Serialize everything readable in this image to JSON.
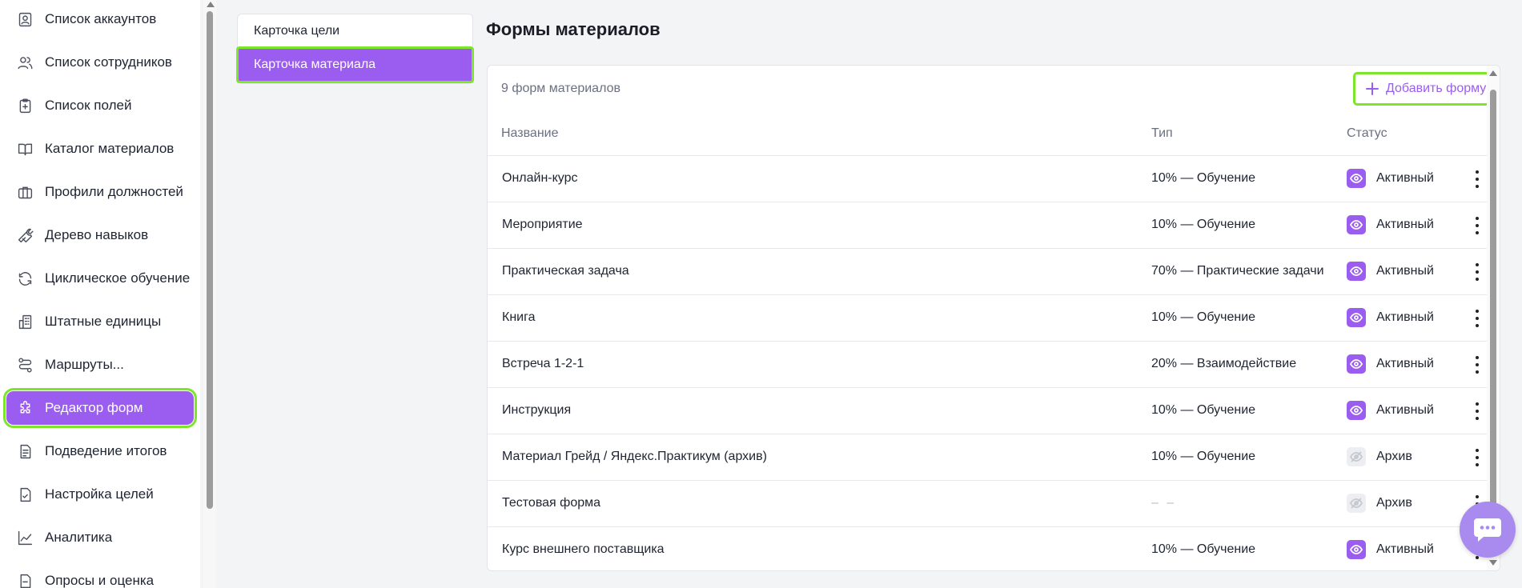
{
  "sidebar": {
    "items": [
      {
        "label": "Список аккаунтов",
        "icon": "user-card-icon"
      },
      {
        "label": "Список сотрудников",
        "icon": "users-icon"
      },
      {
        "label": "Список полей",
        "icon": "clipboard-plus-icon"
      },
      {
        "label": "Каталог материалов",
        "icon": "book-icon"
      },
      {
        "label": "Профили должностей",
        "icon": "briefcase-icon"
      },
      {
        "label": "Дерево навыков",
        "icon": "wrench-icon"
      },
      {
        "label": "Циклическое обучение",
        "icon": "refresh-icon"
      },
      {
        "label": "Штатные единицы",
        "icon": "building-icon"
      },
      {
        "label": "Маршруты...",
        "icon": "route-icon"
      },
      {
        "label": "Редактор форм",
        "icon": "puzzle-icon",
        "active": true
      },
      {
        "label": "Подведение итогов",
        "icon": "document-list-icon"
      },
      {
        "label": "Настройка целей",
        "icon": "document-check-icon"
      },
      {
        "label": "Аналитика",
        "icon": "chart-line-icon"
      },
      {
        "label": "Опросы и оценка",
        "icon": "document-icon"
      }
    ]
  },
  "subnav": {
    "items": [
      {
        "label": "Карточка цели"
      },
      {
        "label": "Карточка материала",
        "active": true
      }
    ]
  },
  "main": {
    "title": "Формы материалов",
    "count": "9 форм материалов",
    "add_label": "Добавить форму",
    "columns": {
      "name": "Название",
      "type": "Тип",
      "status": "Статус"
    },
    "rows": [
      {
        "name": "Онлайн-курс",
        "type": "10% — Обучение",
        "status": "Активный",
        "active": true
      },
      {
        "name": "Мероприятие",
        "type": "10% — Обучение",
        "status": "Активный",
        "active": true
      },
      {
        "name": "Практическая задача",
        "type": "70% — Практические задачи",
        "status": "Активный",
        "active": true
      },
      {
        "name": "Книга",
        "type": "10% — Обучение",
        "status": "Активный",
        "active": true
      },
      {
        "name": "Встреча 1-2-1",
        "type": "20% — Взаимодействие",
        "status": "Активный",
        "active": true
      },
      {
        "name": "Инструкция",
        "type": "10% — Обучение",
        "status": "Активный",
        "active": true
      },
      {
        "name": "Материал Грейд / Яндекс.Практикум (архив)",
        "type": "10% — Обучение",
        "status": "Архив",
        "active": false
      },
      {
        "name": "Тестовая форма",
        "type": "– –",
        "status": "Архив",
        "active": false
      },
      {
        "name": "Курс внешнего поставщика",
        "type": "10% — Обучение",
        "status": "Активный",
        "active": true
      }
    ]
  },
  "colors": {
    "accent": "#9b5cf0",
    "highlight": "#7ee62a",
    "chat": "#a98bf0"
  }
}
